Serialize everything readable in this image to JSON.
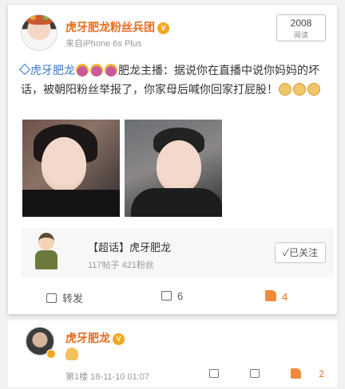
{
  "post": {
    "username": "虎牙肥龙粉丝兵团",
    "source": "来自iPhone 6s Plus",
    "read_count": "2008",
    "read_label": "阅读",
    "mention": "虎牙肥龙",
    "text_after_mention": "肥龙主播：据说你在直播中说你妈妈的坏话，被朝阳粉丝举报了，你家母后喊你回家打屁股！"
  },
  "topic": {
    "title": "【超话】虎牙肥龙",
    "stats": "117帖子 421粉丝",
    "follow_label": "✓已关注"
  },
  "actions": {
    "repost_label": "转发",
    "comment_count": "6",
    "like_count": "4"
  },
  "comment": {
    "username": "虎牙肥龙",
    "meta": "第1楼 18-11-10 01:07",
    "like_count": "2"
  },
  "colors": {
    "accent_orange": "#e86b1c",
    "link_blue": "#3c78c4"
  }
}
